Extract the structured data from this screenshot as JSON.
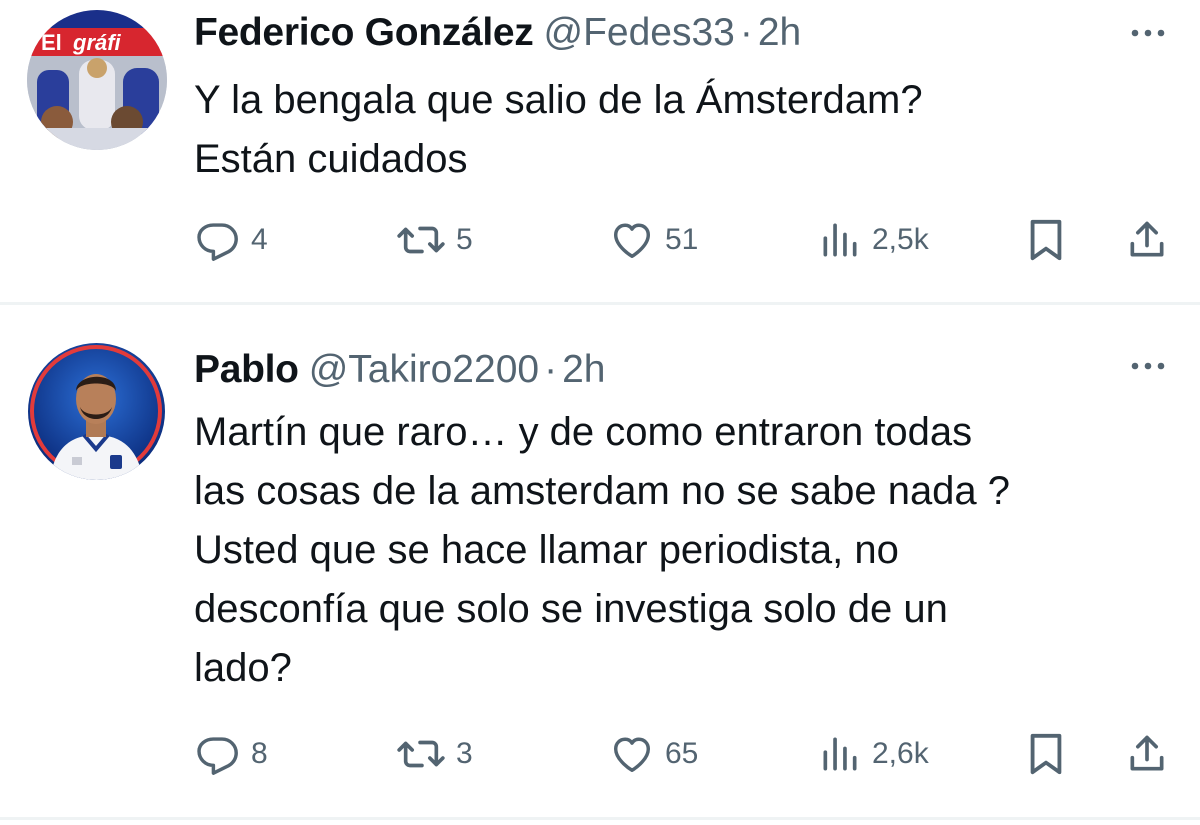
{
  "tweets": [
    {
      "author": {
        "display_name": "Federico González",
        "handle": "@Fedes33",
        "avatar": "newspaper-cover-avatar"
      },
      "separator": "·",
      "time": "2h",
      "text": "Y la bengala que salio de la Ámsterdam?\nEstán cuidados",
      "stats": {
        "replies": "4",
        "retweets": "5",
        "likes": "51",
        "views": "2,5k"
      }
    },
    {
      "author": {
        "display_name": "Pablo",
        "handle": "@Takiro2200",
        "avatar": "football-player-avatar"
      },
      "separator": "·",
      "time": "2h",
      "text": "Martín que raro… y de como entraron todas\nlas cosas de la amsterdam no se sabe nada ?\nUsted que se hace llamar periodista, no\ndesconfía que solo se investiga solo de un\nlado?",
      "stats": {
        "replies": "8",
        "retweets": "3",
        "likes": "65",
        "views": "2,6k"
      }
    }
  ],
  "icons": {
    "reply": "reply-icon",
    "retweet": "retweet-icon",
    "like": "heart-icon",
    "views": "views-icon",
    "bookmark": "bookmark-icon",
    "share": "share-icon",
    "more": "more-icon"
  },
  "colors": {
    "text_primary": "#0f1419",
    "text_secondary": "#536471",
    "divider": "#eff3f4"
  }
}
